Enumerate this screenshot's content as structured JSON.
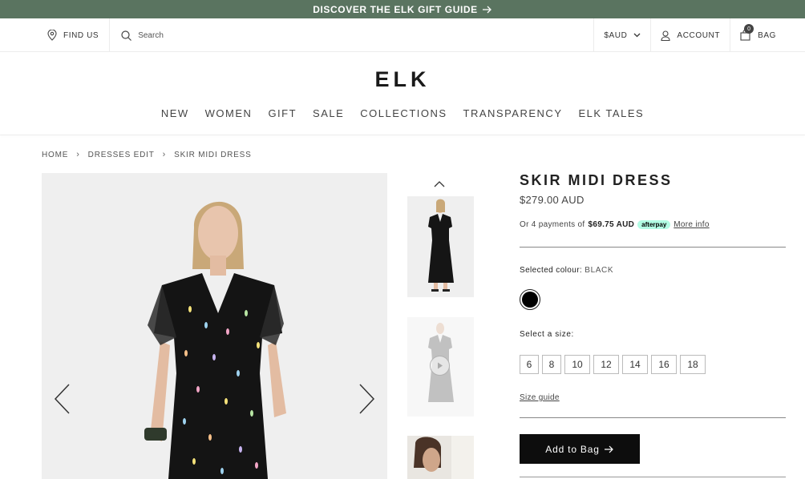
{
  "announcement": {
    "text": "DISCOVER THE ELK GIFT GUIDE",
    "icon": "arrow-right-icon"
  },
  "utility": {
    "find_us": "FIND US",
    "search_placeholder": "Search",
    "currency": "$AUD",
    "account": "ACCOUNT",
    "bag": "BAG",
    "bag_count": "0"
  },
  "brand": {
    "logo": "ELK"
  },
  "nav": [
    "NEW",
    "WOMEN",
    "GIFT",
    "SALE",
    "COLLECTIONS",
    "TRANSPARENCY",
    "ELK TALES"
  ],
  "breadcrumb": [
    "HOME",
    "DRESSES EDIT",
    "SKIR MIDI DRESS"
  ],
  "product": {
    "title": "SKIR MIDI DRESS",
    "price": "$279.00 AUD",
    "afterpay_prefix": "Or 4 payments of",
    "afterpay_amount": "$69.75 AUD",
    "afterpay_badge": "afterpay",
    "more_info": "More info",
    "selected_colour_label": "Selected colour:",
    "selected_colour": "BLACK",
    "swatch_color": "#000000",
    "size_label": "Select a size:",
    "sizes": [
      "6",
      "8",
      "10",
      "12",
      "14",
      "16",
      "18"
    ],
    "size_guide": "Size guide",
    "add_to_bag": "Add to Bag"
  },
  "colors": {
    "announcement_bg": "#5a7460",
    "button_bg": "#0d0d0d",
    "afterpay": "#b2fce4"
  }
}
